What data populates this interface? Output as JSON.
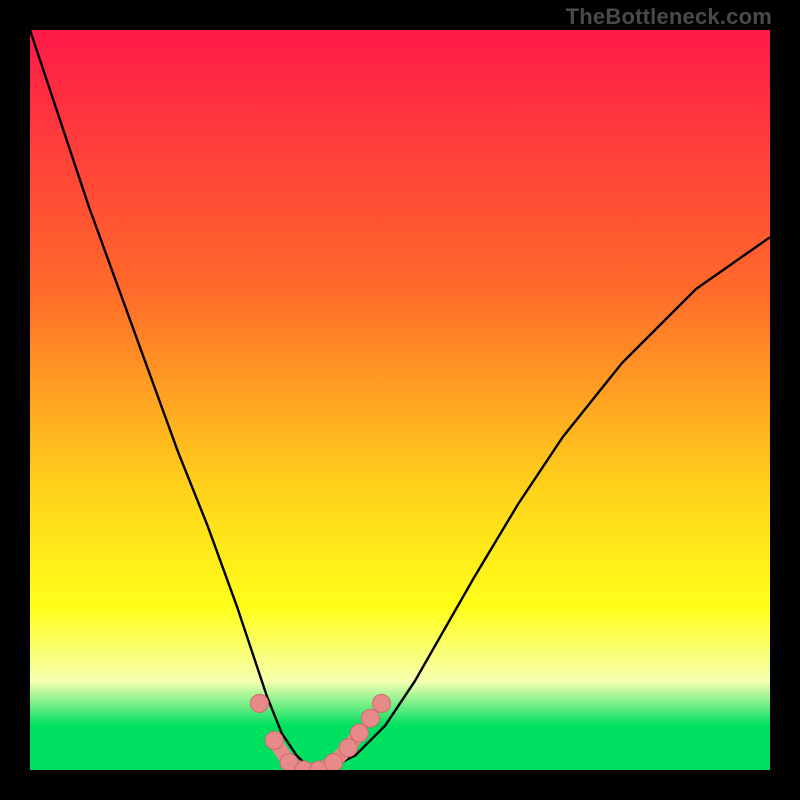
{
  "watermark": "TheBottleneck.com",
  "colors": {
    "bg_black": "#000000",
    "grad_top": "#ff1a48",
    "grad_mid1": "#ff6a2a",
    "grad_mid2": "#ffd21a",
    "grad_yellow": "#ffff1a",
    "grad_pale": "#f6ffb0",
    "grad_green": "#00e060",
    "curve": "#000000",
    "marker_fill": "#e88a8a",
    "marker_stroke": "#d06a6a"
  },
  "chart_data": {
    "type": "line",
    "title": "",
    "xlabel": "",
    "ylabel": "",
    "xlim": [
      0,
      100
    ],
    "ylim": [
      0,
      100
    ],
    "legend": false,
    "grid": false,
    "series": [
      {
        "name": "bottleneck-curve",
        "x": [
          0,
          4,
          8,
          12,
          16,
          20,
          24,
          28,
          30,
          32,
          34,
          36,
          38,
          40,
          44,
          48,
          52,
          56,
          60,
          66,
          72,
          80,
          90,
          100
        ],
        "y": [
          100,
          88,
          76,
          65,
          54,
          43,
          33,
          22,
          16,
          10,
          5,
          2,
          0,
          0,
          2,
          6,
          12,
          19,
          26,
          36,
          45,
          55,
          65,
          72
        ]
      }
    ],
    "markers": {
      "name": "highlighted-points",
      "x": [
        31,
        33,
        35,
        37,
        39,
        41,
        43,
        44.5,
        46,
        47.5
      ],
      "y": [
        9,
        4,
        1,
        0,
        0,
        1,
        3,
        5,
        7,
        9
      ]
    },
    "annotations": []
  }
}
